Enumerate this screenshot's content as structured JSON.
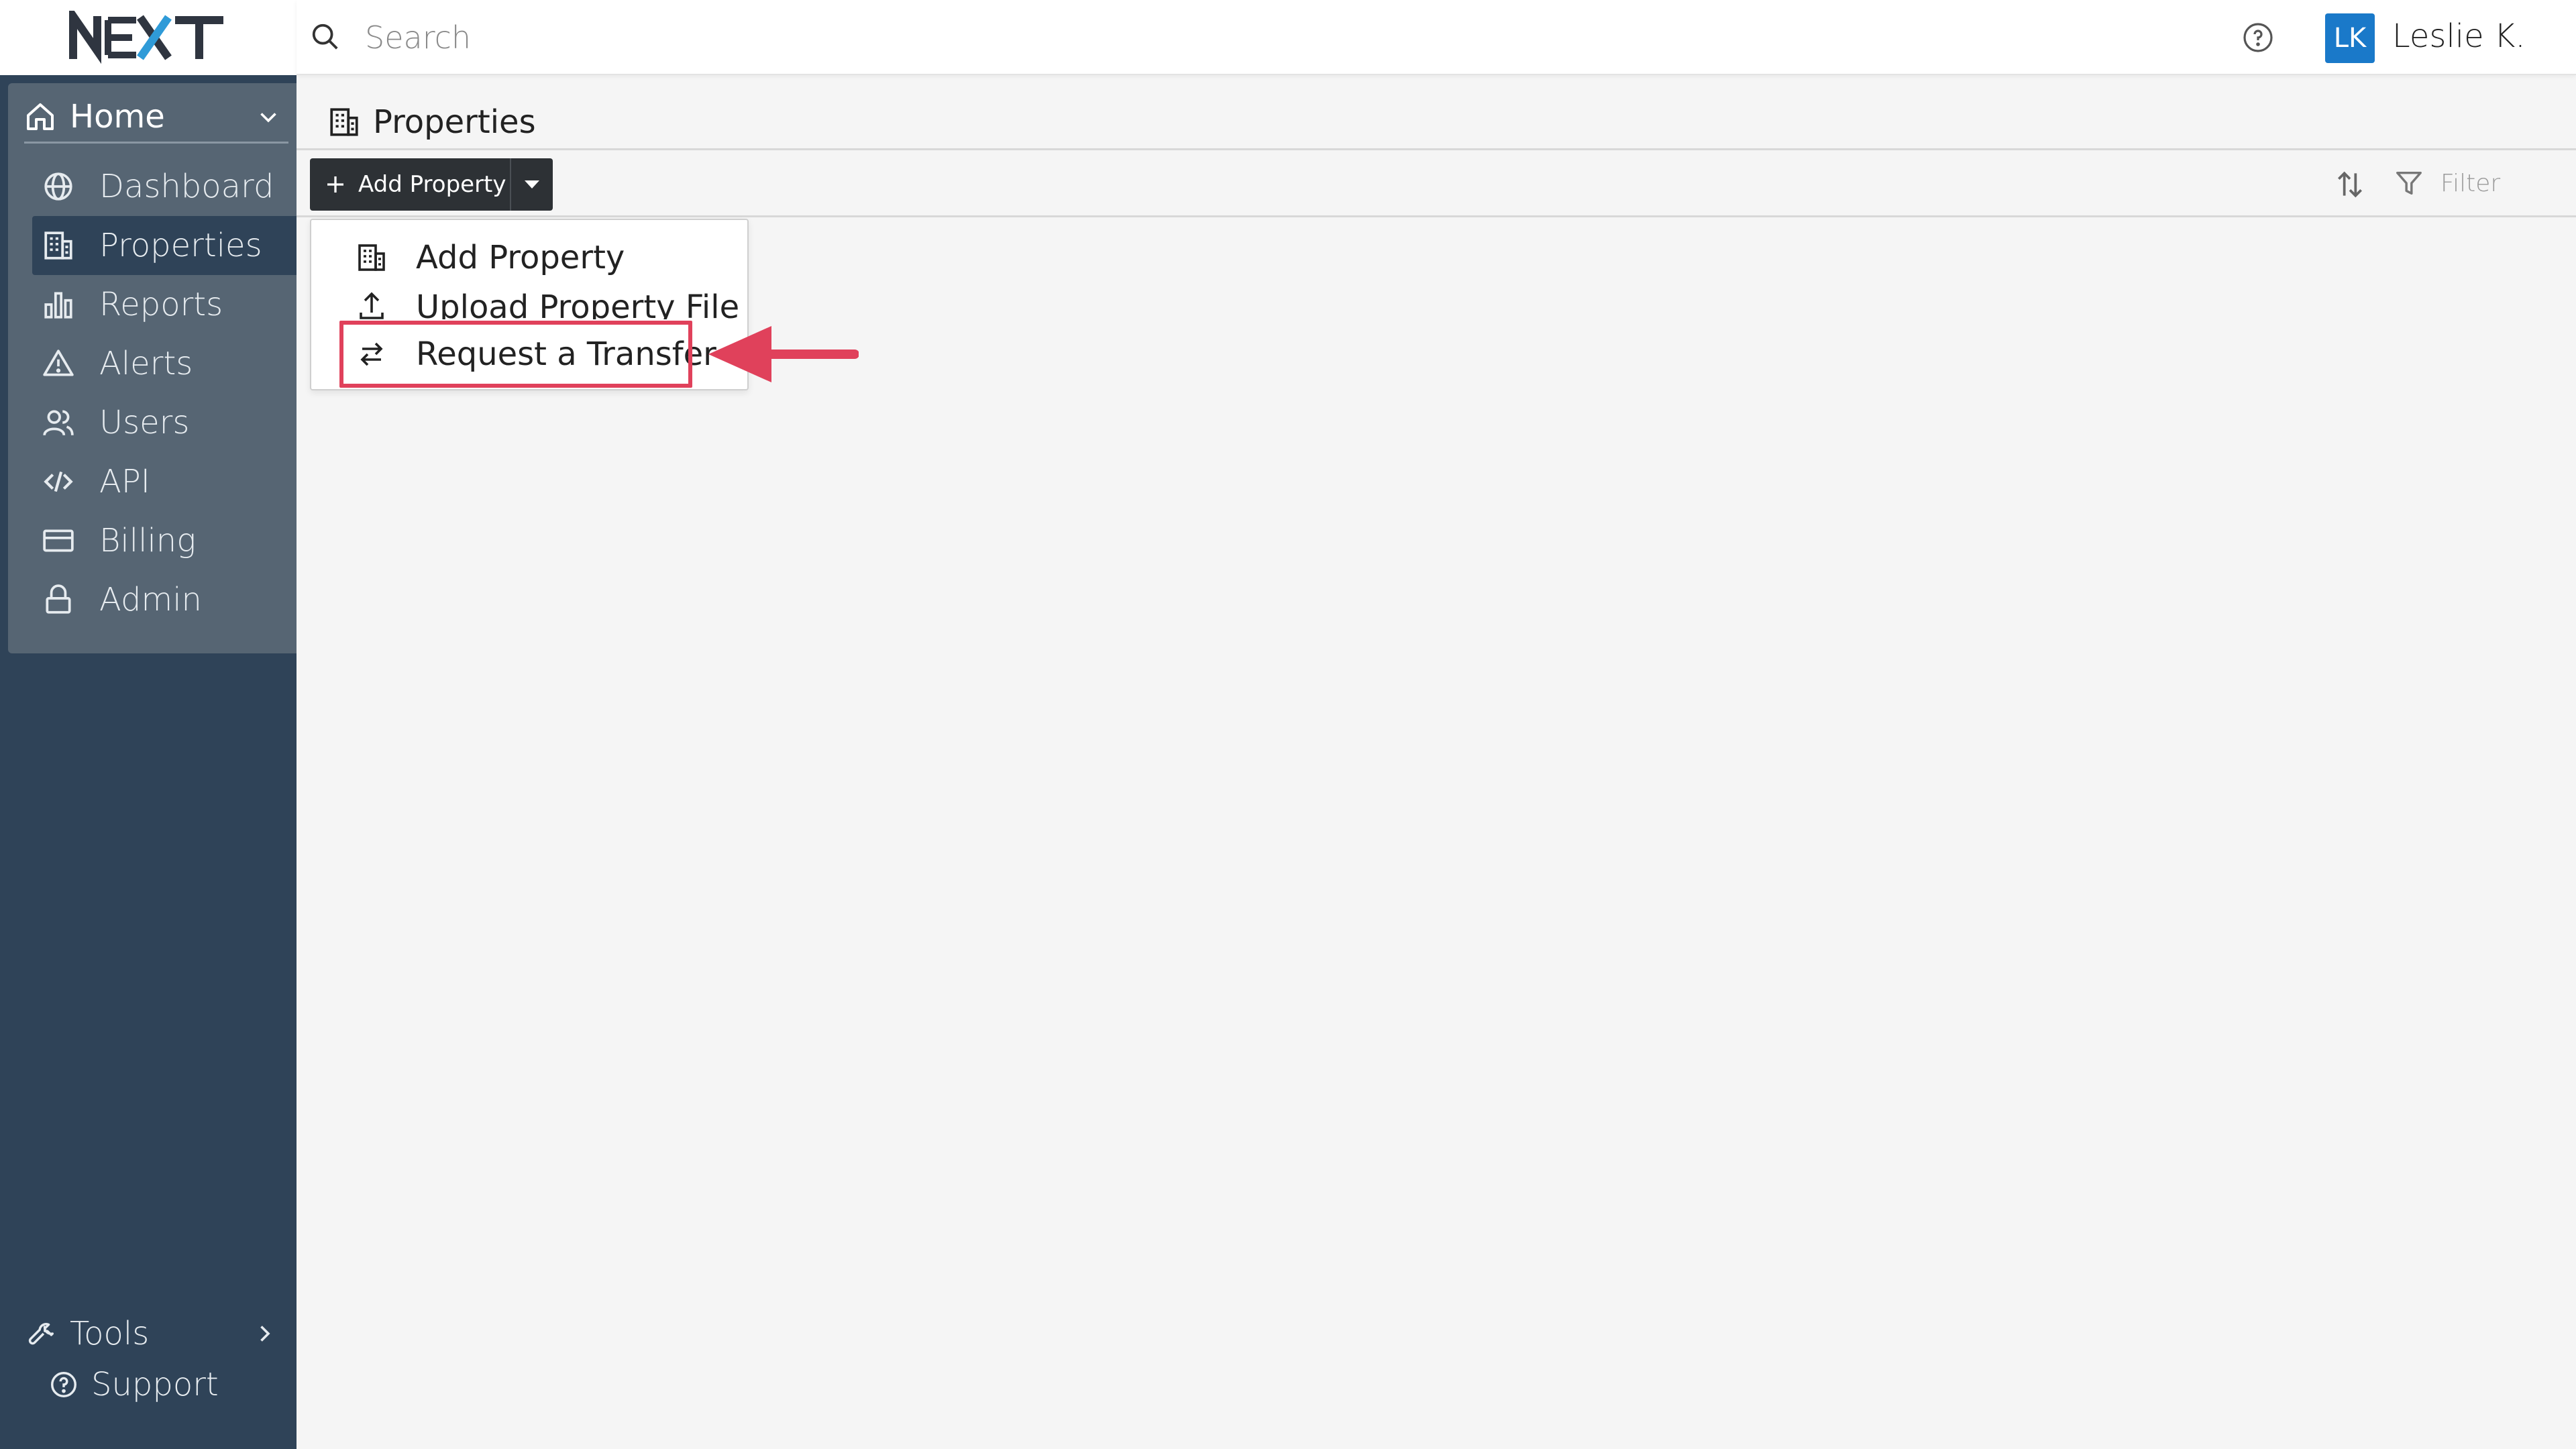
{
  "app": {
    "logo_text": "NEXT"
  },
  "sidebar": {
    "home_label": "Home",
    "items": [
      {
        "label": "Dashboard",
        "icon": "globe-icon"
      },
      {
        "label": "Properties",
        "icon": "building-icon",
        "active": true
      },
      {
        "label": "Reports",
        "icon": "bar-chart-icon"
      },
      {
        "label": "Alerts",
        "icon": "alert-triangle-icon"
      },
      {
        "label": "Users",
        "icon": "users-icon"
      },
      {
        "label": "API",
        "icon": "code-icon"
      },
      {
        "label": "Billing",
        "icon": "credit-card-icon"
      },
      {
        "label": "Admin",
        "icon": "lock-icon"
      }
    ],
    "bottom": {
      "tools_label": "Tools",
      "support_label": "Support"
    }
  },
  "topbar": {
    "search_placeholder": "Search",
    "avatar_initials": "LK",
    "user_name": "Leslie K."
  },
  "page": {
    "title": "Properties"
  },
  "toolbar": {
    "add_label": "Add Property",
    "filter_label": "Filter"
  },
  "dropdown": {
    "items": [
      {
        "label": "Add Property",
        "icon": "building-icon"
      },
      {
        "label": "Upload Property File",
        "icon": "upload-icon"
      },
      {
        "label": "Request a Transfer",
        "icon": "transfer-icon"
      }
    ]
  },
  "colors": {
    "sidebar_bg": "#2f4358",
    "home_panel_bg": "#566573",
    "avatar_bg": "#1a79c9",
    "button_bg": "#2d3135",
    "highlight": "#e0415b"
  }
}
